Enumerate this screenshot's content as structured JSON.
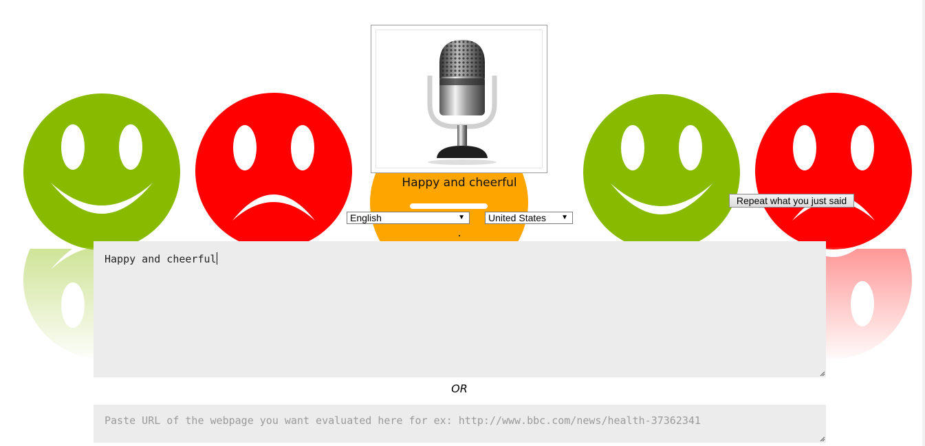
{
  "status": {
    "recognized_text": "Happy and cheerful"
  },
  "language_select": {
    "selected": "English"
  },
  "region_select": {
    "selected": "United States"
  },
  "repeat_button": {
    "label": "Repeat what you just said"
  },
  "transcript": {
    "value": "Happy and cheerful"
  },
  "divider": {
    "or_label": "OR"
  },
  "url_input": {
    "placeholder": "Paste URL of the webpage you want evaluated here for ex: http://www.bbc.com/news/health-37362341"
  },
  "colors": {
    "happy_face": "#88bb00",
    "sad_face": "#ff0000",
    "orange_accent": "#ffa500",
    "textarea_bg": "#ececec"
  },
  "icons": {
    "microphone": "microphone-icon",
    "happy": "happy-face-icon",
    "sad": "sad-face-icon"
  }
}
